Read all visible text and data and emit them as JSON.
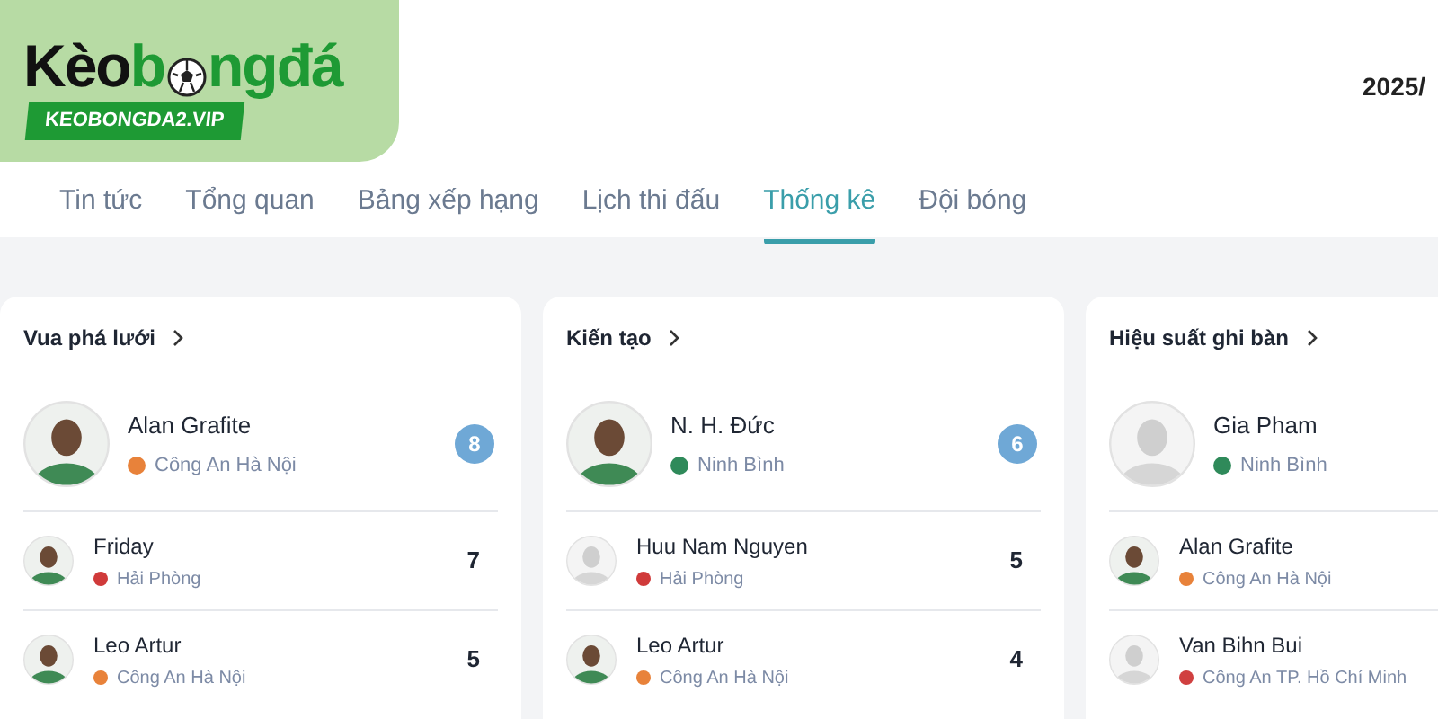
{
  "logo": {
    "word_dark": "Kèo",
    "word_green_start": "b",
    "word_green_end": "ngđá",
    "domain": "KEOBONGDA2.VIP"
  },
  "date": "2025/",
  "tabs": [
    {
      "label": "Tin tức",
      "selected": false
    },
    {
      "label": "Tổng quan",
      "selected": false
    },
    {
      "label": "Bảng xếp hạng",
      "selected": false
    },
    {
      "label": "Lịch thi đấu",
      "selected": false
    },
    {
      "label": "Thống kê",
      "selected": true
    },
    {
      "label": "Đội bóng",
      "selected": false
    }
  ],
  "cards": [
    {
      "title": "Vua phá lưới",
      "leader": {
        "name": "Alan Grafite",
        "club": "Công An Hà Nội",
        "color": "#e8823a",
        "kind": "photo",
        "value": "8"
      },
      "rows": [
        {
          "name": "Friday",
          "club": "Hải Phòng",
          "color": "#d03a3a",
          "kind": "photo",
          "value": "7"
        },
        {
          "name": "Leo Artur",
          "club": "Công An Hà Nội",
          "color": "#e8823a",
          "kind": "photo",
          "value": "5"
        }
      ]
    },
    {
      "title": "Kiến tạo",
      "leader": {
        "name": "N. H. Đức",
        "club": "Ninh Bình",
        "color": "#2f8a5a",
        "kind": "photo",
        "value": "6"
      },
      "rows": [
        {
          "name": "Huu Nam Nguyen",
          "club": "Hải Phòng",
          "color": "#d03a3a",
          "kind": "placeholder",
          "value": "5"
        },
        {
          "name": "Leo Artur",
          "club": "Công An Hà Nội",
          "color": "#e8823a",
          "kind": "photo",
          "value": "4"
        }
      ]
    },
    {
      "title": "Hiệu suất ghi bàn",
      "leader": {
        "name": "Gia Pham",
        "club": "Ninh Bình",
        "color": "#2f8a5a",
        "kind": "placeholder"
      },
      "rows": [
        {
          "name": "Alan Grafite",
          "club": "Công An Hà Nội",
          "color": "#e8823a",
          "kind": "photo"
        },
        {
          "name": "Van Bihn Bui",
          "club": "Công An TP. Hồ Chí Minh",
          "color": "#d04040",
          "kind": "placeholder"
        }
      ]
    }
  ]
}
